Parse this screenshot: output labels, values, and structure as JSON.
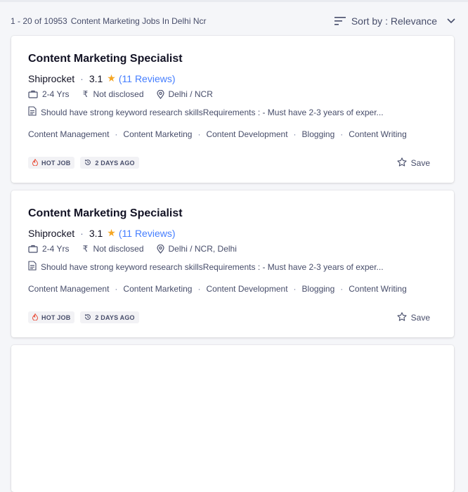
{
  "results": {
    "count_text": "1 - 20 of 10953",
    "query_text": "Content Marketing Jobs In Delhi Ncr"
  },
  "sort": {
    "label": "Sort by : Relevance",
    "icon": "sort-lines-icon",
    "chevron": "chevron-down-icon"
  },
  "jobs": [
    {
      "title": "Content Marketing Specialist",
      "company": "Shiprocket",
      "rating": "3.1",
      "reviews": "(11 Reviews)",
      "experience": "2-4 Yrs",
      "salary": "Not disclosed",
      "location": "Delhi / NCR",
      "description": "Should have strong keyword research skillsRequirements : - Must have 2-3 years of exper...",
      "tags": [
        "Content Management",
        "Content Marketing",
        "Content Development",
        "Blogging",
        "Content Writing"
      ],
      "hot_label": "HOT JOB",
      "posted": "2 DAYS AGO",
      "save_label": "Save"
    },
    {
      "title": "Content Marketing Specialist",
      "company": "Shiprocket",
      "rating": "3.1",
      "reviews": "(11 Reviews)",
      "experience": "2-4 Yrs",
      "salary": "Not disclosed",
      "location": "Delhi / NCR, Delhi",
      "description": "Should have strong keyword research skillsRequirements : - Must have 2-3 years of exper...",
      "tags": [
        "Content Management",
        "Content Marketing",
        "Content Development",
        "Blogging",
        "Content Writing"
      ],
      "hot_label": "HOT JOB",
      "posted": "2 DAYS AGO",
      "save_label": "Save"
    }
  ],
  "colors": {
    "star": "#f5a623",
    "link": "#457eff",
    "hot": "#e9503c"
  }
}
